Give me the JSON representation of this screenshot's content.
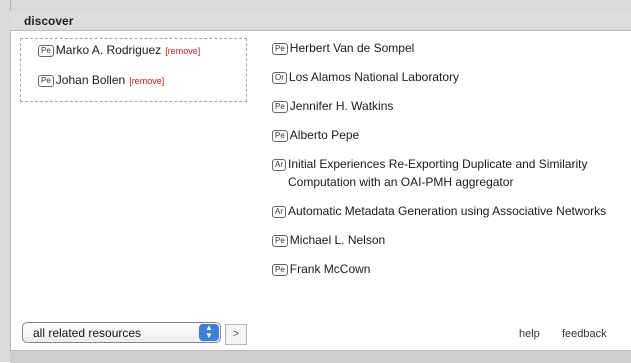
{
  "panel": {
    "title": "discover"
  },
  "selected": [
    {
      "type": "Pe",
      "name": "Marko A. Rodriguez",
      "remove": "[remove]"
    },
    {
      "type": "Pe",
      "name": "Johan Bollen",
      "remove": "[remove]"
    }
  ],
  "related": [
    {
      "type": "Pe",
      "name": "Herbert Van de Sompel"
    },
    {
      "type": "Or",
      "name": "Los Alamos National Laboratory"
    },
    {
      "type": "Pe",
      "name": "Jennifer H. Watkins"
    },
    {
      "type": "Pe",
      "name": "Alberto Pepe"
    },
    {
      "type": "Ar",
      "name": "Initial Experiences Re-Exporting Duplicate and Similarity Computation with an OAI-PMH aggregator"
    },
    {
      "type": "Ar",
      "name": "Automatic Metadata Generation using Associative Networks"
    },
    {
      "type": "Pe",
      "name": "Michael L. Nelson"
    },
    {
      "type": "Pe",
      "name": "Frank McCown"
    }
  ],
  "controls": {
    "filter_value": "all related resources",
    "go_label": ">",
    "help": "help",
    "feedback": "feedback"
  },
  "colors": {
    "border": "#8b1a1a",
    "remove": "#b22222",
    "select_arrow": "#3d7ed8"
  }
}
